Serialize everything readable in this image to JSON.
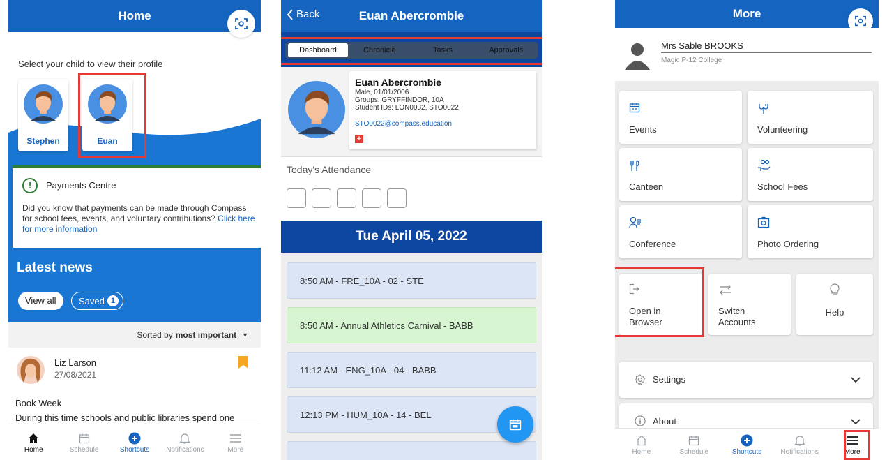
{
  "colors": {
    "primary": "#1565c0",
    "highlight": "#e53935",
    "event_green": "#d7f5d0",
    "schedule_blue": "#dbe5f5"
  },
  "screen1": {
    "title": "Home",
    "select_prompt": "Select your child to view their profile",
    "children": [
      {
        "name": "Stephen"
      },
      {
        "name": "Euan"
      }
    ],
    "payments": {
      "title": "Payments Centre",
      "body": "Did you know that payments can be made through Compass for school fees, events, and voluntary contributions?",
      "link": "Click here for more information"
    },
    "latest_news": "Latest news",
    "view_all": "View all",
    "saved": "Saved",
    "saved_count": "1",
    "sorted_by_prefix": "Sorted by",
    "sorted_by_value": "most important",
    "news_item": {
      "author": "Liz Larson",
      "date": "27/08/2021",
      "headline": "Book Week",
      "excerpt": "During this time schools and public libraries spend one"
    },
    "tabs": [
      "Home",
      "Schedule",
      "Shortcuts",
      "Notifications",
      "More"
    ]
  },
  "screen2": {
    "back": "Back",
    "title": "Euan Abercrombie",
    "tabs": [
      "Dashboard",
      "Chronicle",
      "Tasks",
      "Approvals"
    ],
    "profile": {
      "name": "Euan Abercrombie",
      "line1": "Male, 01/01/2006",
      "line2": "Groups: GRYFFINDOR, 10A",
      "line3": "Student IDs: LON0032, STO0022",
      "email": "STO0022@compass.education"
    },
    "attendance_title": "Today's Attendance",
    "date": "Tue April 05, 2022",
    "schedule": [
      "8:50 AM - FRE_10A - 02 - STE",
      "8:50 AM - Annual Athletics Carnival - BABB",
      "11:12 AM - ENG_10A - 04 - BABB",
      "12:13 PM - HUM_10A - 14 - BEL"
    ]
  },
  "screen3": {
    "title": "More",
    "user_name": "Mrs Sable BROOKS",
    "school": "Magic P-12 College",
    "tiles": [
      "Events",
      "Volunteering",
      "Canteen",
      "School Fees",
      "Conference",
      "Photo Ordering"
    ],
    "actions": [
      "Open in Browser",
      "Switch Accounts",
      "Help"
    ],
    "settings": "Settings",
    "about": "About",
    "tabs": [
      "Home",
      "Schedule",
      "Shortcuts",
      "Notifications",
      "More"
    ]
  }
}
